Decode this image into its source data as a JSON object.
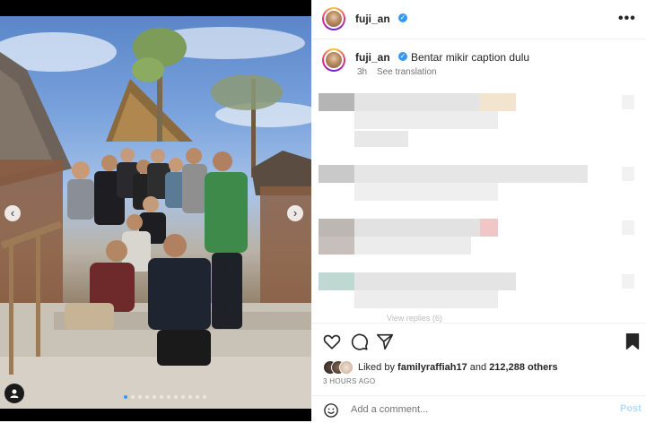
{
  "post": {
    "username": "fuji_an",
    "more_label": "•••",
    "caption": "Bentar mikir caption dulu",
    "time_ago": "3h",
    "see_translation": "See translation",
    "view_replies": "View replies (6)",
    "likes_prefix": "Liked by",
    "liked_by_user": "familyraffiah17",
    "likes_join": "and",
    "likes_count": "212,288 others",
    "date_label": "3 HOURS AGO",
    "comment_placeholder": "Add a comment...",
    "post_label": "Post"
  },
  "carousel": {
    "prev_label": "‹",
    "next_label": "›",
    "total_slides": 12,
    "active_slide": 1
  },
  "icons": {
    "heart": "heart-icon",
    "comment": "comment-icon",
    "share": "share-icon",
    "save": "bookmark-icon",
    "emoji": "emoji-icon",
    "tag": "user-tag-icon",
    "verified": "verified-badge-icon"
  },
  "colors": {
    "accent": "#3897f0",
    "post_disabled": "#b3dbff",
    "muted": "#737373"
  }
}
